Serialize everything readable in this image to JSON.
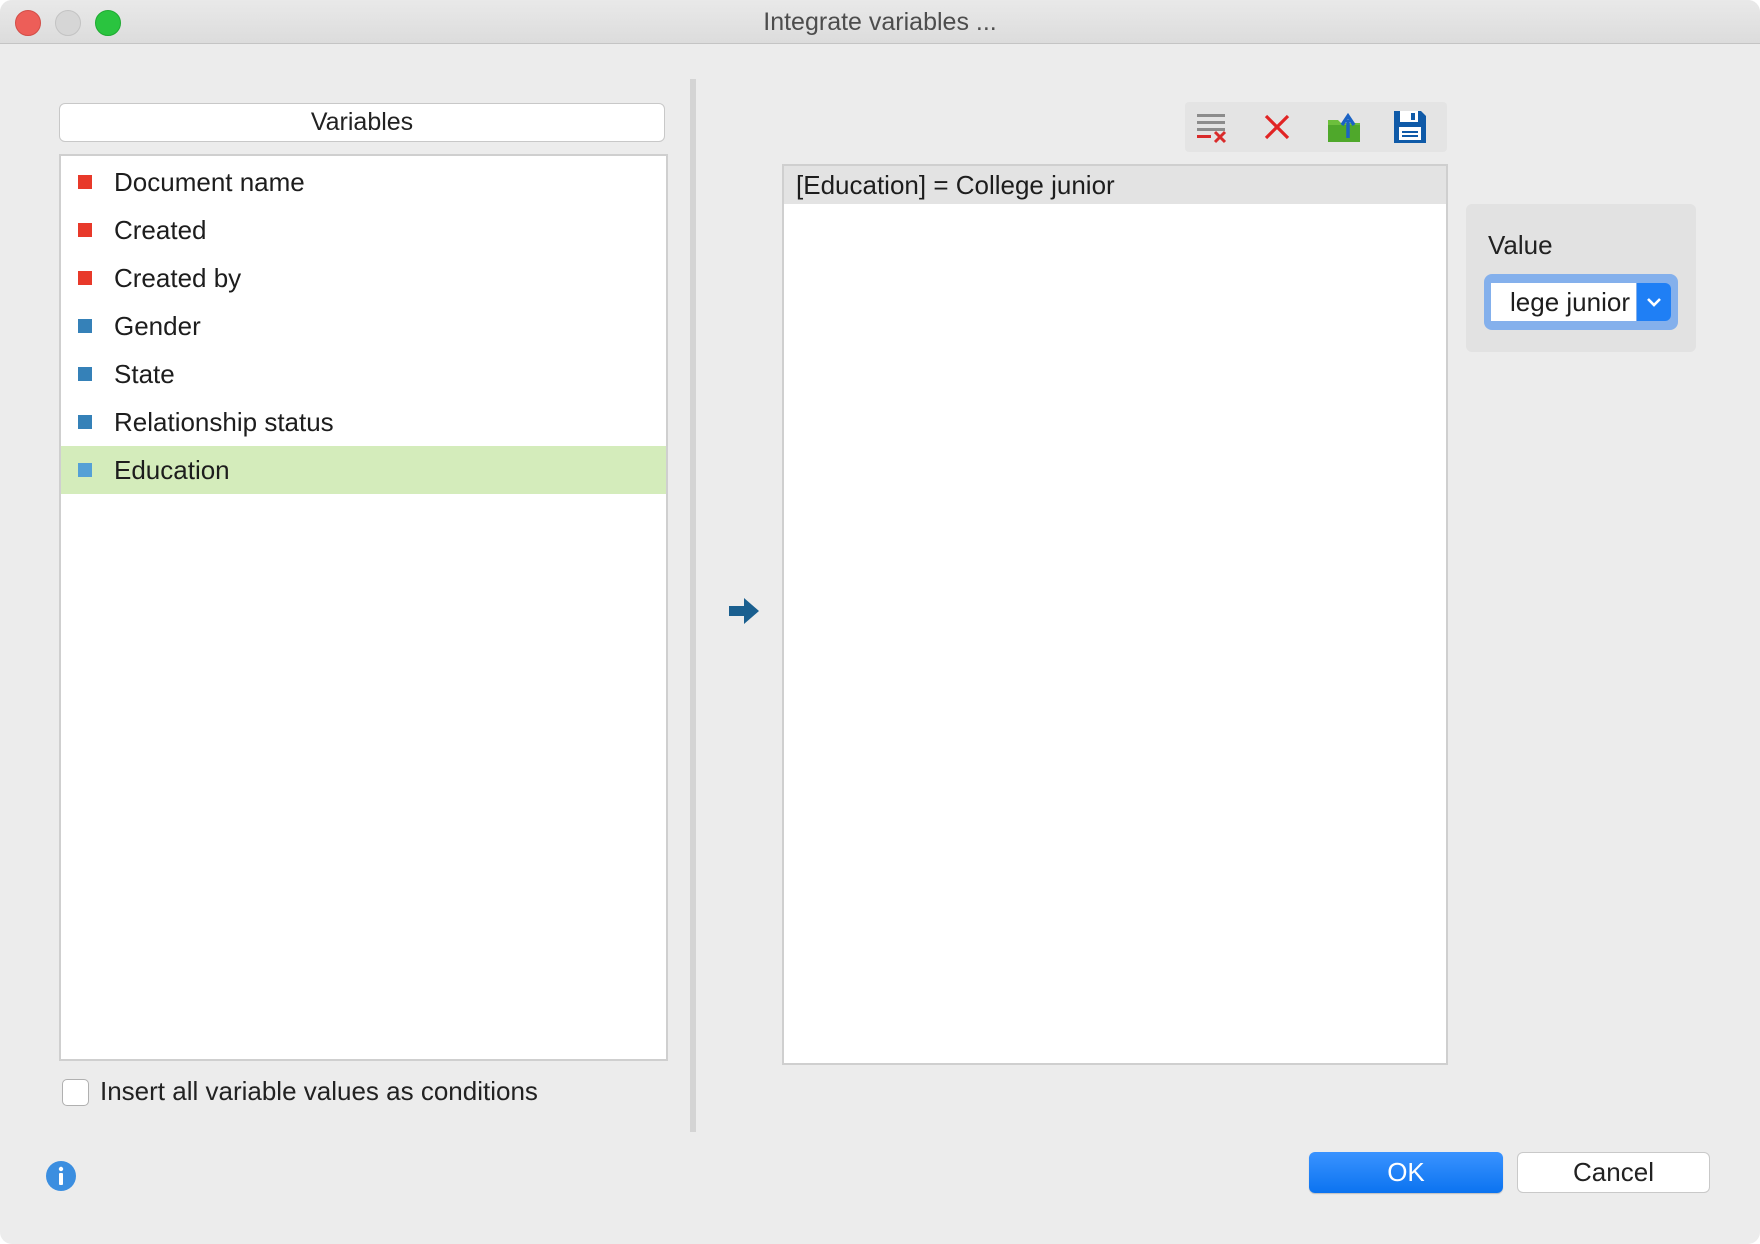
{
  "window": {
    "title": "Integrate variables ..."
  },
  "variables": {
    "header": "Variables",
    "items": [
      {
        "label": "Document name",
        "color": "#e8392a"
      },
      {
        "label": "Created",
        "color": "#e8392a"
      },
      {
        "label": "Created by",
        "color": "#e8392a"
      },
      {
        "label": "Gender",
        "color": "#3581b8"
      },
      {
        "label": "State",
        "color": "#3581b8"
      },
      {
        "label": "Relationship status",
        "color": "#3581b8"
      },
      {
        "label": "Education",
        "color": "#55a0d6",
        "selected": true
      }
    ],
    "insert_all_checkbox": {
      "label": "Insert all variable values as conditions",
      "checked": false
    }
  },
  "toolbar": {
    "icons": [
      "clear-list-icon",
      "delete-icon",
      "export-icon",
      "save-icon"
    ]
  },
  "conditions": {
    "items": [
      "[Education] = College junior"
    ]
  },
  "value_panel": {
    "label": "Value",
    "selected_value": "lege junior"
  },
  "buttons": {
    "ok": "OK",
    "cancel": "Cancel"
  },
  "colors": {
    "accent": "#0b73f0",
    "selection": "#d4ecbb"
  }
}
